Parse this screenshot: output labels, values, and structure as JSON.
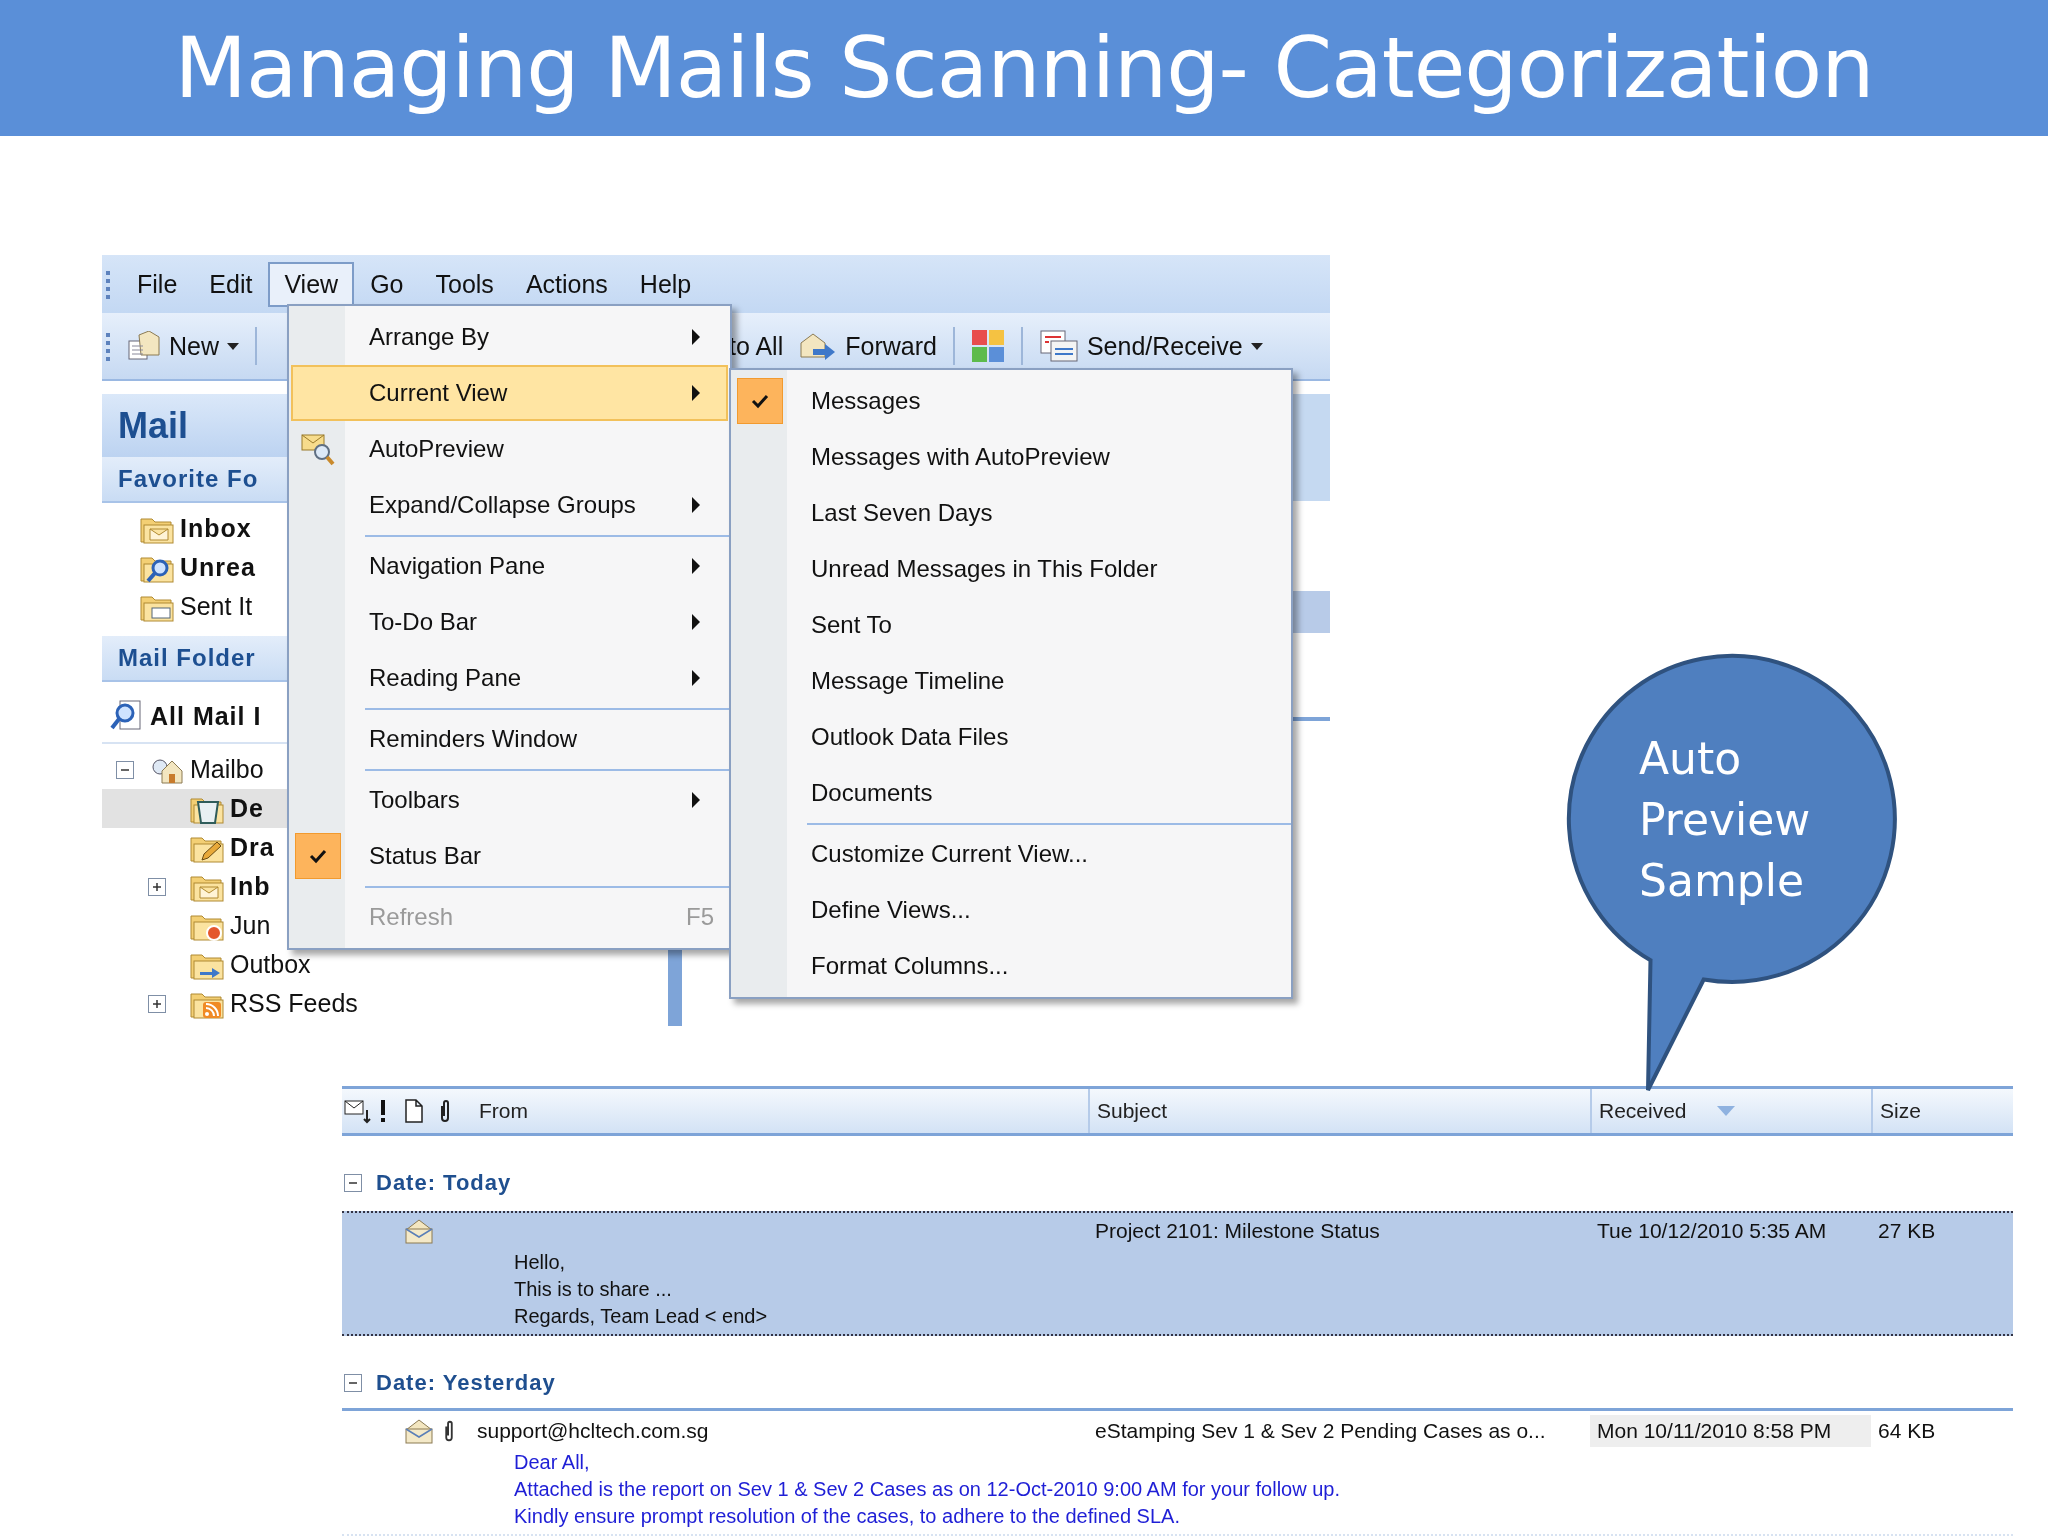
{
  "title": "Managing Mails Scanning- Categorization",
  "menu_bar": [
    {
      "label": "File",
      "selected": false
    },
    {
      "label": "Edit",
      "selected": false
    },
    {
      "label": "View",
      "selected": true
    },
    {
      "label": "Go",
      "selected": false
    },
    {
      "label": "Tools",
      "selected": false
    },
    {
      "label": "Actions",
      "selected": false
    },
    {
      "label": "Help",
      "selected": false
    }
  ],
  "toolbar": {
    "left": [
      {
        "label": "New",
        "dropdown": true
      }
    ],
    "right": [
      {
        "label": "to All",
        "dropdown": false
      },
      {
        "label": "Forward",
        "dropdown": false
      },
      {
        "dropdown": false
      },
      {
        "label": "Send/Receive",
        "dropdown": true
      }
    ]
  },
  "navigation_pane": {
    "title": "Mail",
    "favorites_header": "Favorite Fo",
    "favorites": [
      {
        "label": "Inbox",
        "bold": true
      },
      {
        "label": "Unrea",
        "bold": true
      },
      {
        "label": "Sent It",
        "bold": false
      }
    ],
    "folders_header": "Mail Folder",
    "all_items": "All Mail I",
    "tree": [
      {
        "label": "Mailbo",
        "bold": false,
        "selected": false,
        "expanded": true,
        "children": [
          {
            "label": "De",
            "bold": true,
            "selected": true
          },
          {
            "label": "Dra",
            "bold": true,
            "selected": false
          },
          {
            "label": "Inb",
            "bold": true,
            "selected": false,
            "expanded": false
          },
          {
            "label": "Jun",
            "bold": false,
            "selected": false
          },
          {
            "label": "Outbox",
            "bold": false,
            "selected": false
          },
          {
            "label": "RSS Feeds",
            "bold": false,
            "selected": false,
            "expanded": false
          }
        ]
      }
    ]
  },
  "view_menu": [
    {
      "kind": "submenu",
      "label": "Arrange By",
      "selected": false,
      "checked": false,
      "disabled": false
    },
    {
      "kind": "submenu",
      "label": "Current View",
      "selected": true,
      "checked": false,
      "disabled": false
    },
    {
      "kind": "command",
      "label": "AutoPreview",
      "selected": false,
      "checked": false,
      "disabled": false
    },
    {
      "kind": "submenu",
      "label": "Expand/Collapse Groups",
      "selected": false,
      "checked": false,
      "disabled": false
    },
    {
      "kind": "separator"
    },
    {
      "kind": "submenu",
      "label": "Navigation Pane",
      "selected": false,
      "checked": false,
      "disabled": false
    },
    {
      "kind": "submenu",
      "label": "To-Do Bar",
      "selected": false,
      "checked": false,
      "disabled": false
    },
    {
      "kind": "submenu",
      "label": "Reading Pane",
      "selected": false,
      "checked": false,
      "disabled": false
    },
    {
      "kind": "separator"
    },
    {
      "kind": "command",
      "label": "Reminders Window",
      "selected": false,
      "checked": false,
      "disabled": false
    },
    {
      "kind": "separator"
    },
    {
      "kind": "submenu",
      "label": "Toolbars",
      "selected": false,
      "checked": false,
      "disabled": false
    },
    {
      "kind": "command",
      "label": "Status Bar",
      "selected": false,
      "checked": true,
      "disabled": false
    },
    {
      "kind": "separator"
    },
    {
      "kind": "command",
      "label": "Refresh",
      "shortcut": "F5",
      "selected": false,
      "checked": false,
      "disabled": true
    }
  ],
  "current_view_menu": [
    {
      "kind": "command",
      "label": "Messages",
      "selected": false,
      "checked": true,
      "disabled": false
    },
    {
      "kind": "command",
      "label": "Messages with AutoPreview",
      "selected": false,
      "checked": false,
      "disabled": false
    },
    {
      "kind": "command",
      "label": "Last Seven Days",
      "selected": false,
      "checked": false,
      "disabled": false
    },
    {
      "kind": "command",
      "label": "Unread Messages in This Folder",
      "selected": false,
      "checked": false,
      "disabled": false
    },
    {
      "kind": "command",
      "label": "Sent To",
      "selected": false,
      "checked": false,
      "disabled": false
    },
    {
      "kind": "command",
      "label": "Message Timeline",
      "selected": false,
      "checked": false,
      "disabled": false
    },
    {
      "kind": "command",
      "label": "Outlook Data Files",
      "selected": false,
      "checked": false,
      "disabled": false
    },
    {
      "kind": "command",
      "label": "Documents",
      "selected": false,
      "checked": false,
      "disabled": false
    },
    {
      "kind": "separator"
    },
    {
      "kind": "command",
      "label": "Customize Current View...",
      "selected": false,
      "checked": false,
      "disabled": false
    },
    {
      "kind": "command",
      "label": "Define Views...",
      "selected": false,
      "checked": false,
      "disabled": false
    },
    {
      "kind": "command",
      "label": "Format Columns...",
      "selected": false,
      "checked": false,
      "disabled": false
    }
  ],
  "callout": "Auto Preview Sample",
  "message_list": {
    "columns": [
      {
        "label": "From",
        "sorted": false
      },
      {
        "label": "Subject",
        "sorted": false
      },
      {
        "label": "Received",
        "sorted": true
      },
      {
        "label": "Size",
        "sorted": false
      }
    ],
    "groups": [
      {
        "label": "Date: Today",
        "expanded": true,
        "rows": [
          {
            "selected": true,
            "attachment": false,
            "subject": "Project 2101: Milestone Status",
            "received": "Tue 10/12/2010 5:35 AM",
            "size": "27 KB",
            "preview": [
              "Hello,",
              "This is to share ...",
              "Regards, Team Lead < end>"
            ]
          }
        ]
      },
      {
        "label": "Date: Yesterday",
        "expanded": true,
        "rows": [
          {
            "selected": false,
            "attachment": true,
            "from": "support@hcltech.com.sg",
            "subject": "eStamping Sev 1 & Sev 2 Pending Cases as o...",
            "received": "Mon 10/11/2010 8:58 PM",
            "size": "64 KB",
            "preview": [
              "Dear All,",
              "Attached is the report on Sev 1 & Sev 2 Cases as on 12-Oct-2010 9:00 AM for your follow up.",
              "Kindly ensure prompt resolution of the cases, to adhere to the defined SLA."
            ]
          }
        ]
      }
    ]
  }
}
